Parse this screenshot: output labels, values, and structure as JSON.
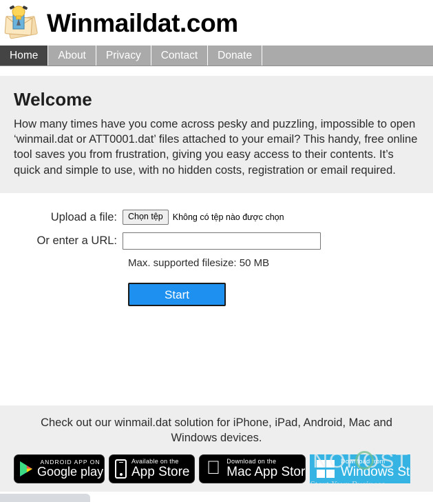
{
  "header": {
    "logo_icon": "winmail-envelope-icon",
    "title": "Winmaildat.com"
  },
  "nav": {
    "items": [
      {
        "label": "Home",
        "active": true
      },
      {
        "label": "About",
        "active": false
      },
      {
        "label": "Privacy",
        "active": false
      },
      {
        "label": "Contact",
        "active": false
      },
      {
        "label": "Donate",
        "active": false
      }
    ]
  },
  "welcome": {
    "title": "Welcome",
    "body": "How many times have you come across pesky and puzzling, impossible to open ‘winmail.dat or ATT0001.dat’ files attached to your email? This handy, free online tool saves you from frustration, giving you easy access to their contents. It’s quick and simple to use, with no hidden costs, registration or email required."
  },
  "form": {
    "upload_label": "Upload a file:",
    "file_button_label": "Chọn tệp",
    "file_status": "Không có tệp nào được chọn",
    "url_label": "Or enter a URL:",
    "url_value": "",
    "url_placeholder": "",
    "filesize_note": "Max. supported filesize: 50 MB",
    "start_label": "Start"
  },
  "footer": {
    "text": "Check out our winmail.dat solution for iPhone, iPad, Android, Mac and Windows devices.",
    "badges": [
      {
        "name": "google-play-badge",
        "small": "ANDROID APP ON",
        "big": "Google play",
        "big_part1": "Google",
        "big_part2": "play"
      },
      {
        "name": "app-store-badge",
        "small": "Available on the",
        "big": "App Store"
      },
      {
        "name": "mac-app-store-badge",
        "small": "Download on the",
        "big": "Mac App Store"
      },
      {
        "name": "windows-store-badge",
        "small": "Download from",
        "big": "Windows Store"
      }
    ]
  },
  "watermark": {
    "main": "INOHOST",
    "sub": "Start Your Business"
  },
  "colors": {
    "nav_bg": "#aaaaaa",
    "nav_active_bg": "#444444",
    "panel_bg": "#eeeeee",
    "accent_blue": "#1e90ef",
    "windows_blue": "#35b4e3"
  }
}
